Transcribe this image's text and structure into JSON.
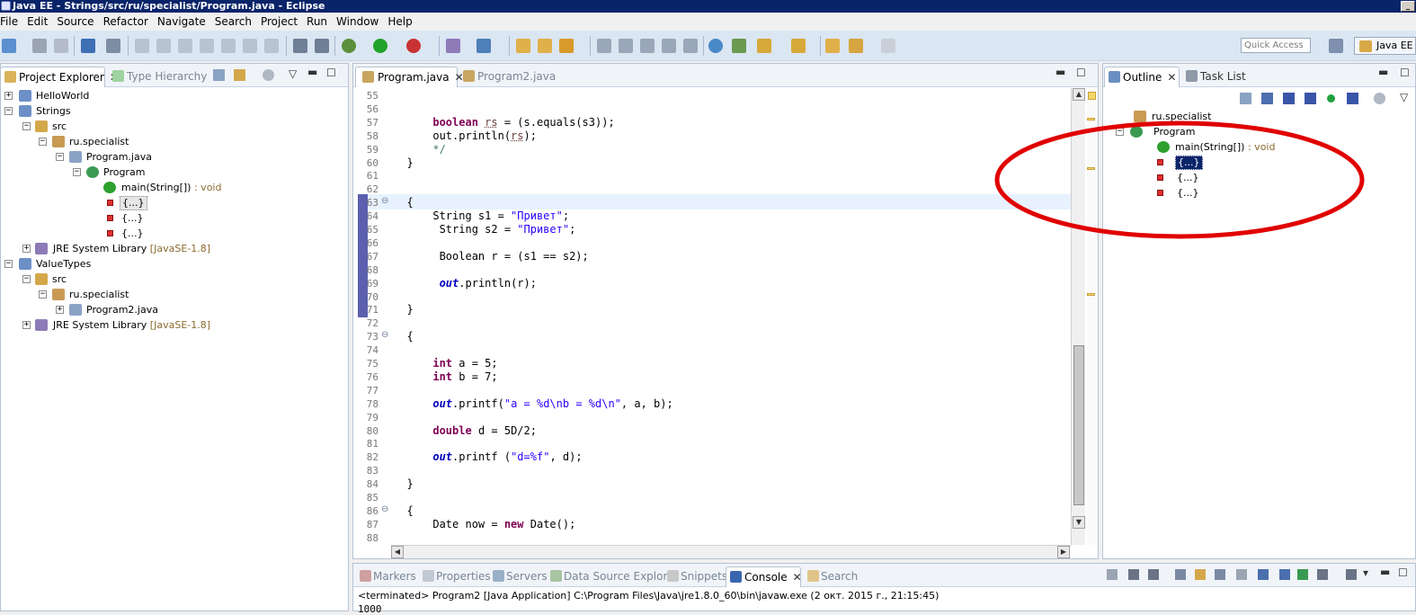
{
  "window": {
    "title": "Java EE - Strings/src/ru/specialist/Program.java - Eclipse"
  },
  "menu": [
    "File",
    "Edit",
    "Source",
    "Refactor",
    "Navigate",
    "Search",
    "Project",
    "Run",
    "Window",
    "Help"
  ],
  "toolbar": {
    "quick_access_placeholder": "Quick Access",
    "perspective": "Java EE"
  },
  "project_explorer": {
    "tabs": [
      {
        "label": "Project Explorer",
        "active": true
      },
      {
        "label": "Type Hierarchy",
        "active": false
      }
    ],
    "tree": [
      {
        "label": "HelloWorld"
      },
      {
        "label": "Strings"
      },
      {
        "label": "src"
      },
      {
        "label": "ru.specialist"
      },
      {
        "label": "Program.java"
      },
      {
        "label": "Program"
      },
      {
        "label": "main(String[])",
        "suffix": " : void"
      },
      {
        "label": "{...}"
      },
      {
        "label": "{...}"
      },
      {
        "label": "{...}"
      },
      {
        "label": "JRE System Library",
        "suffix": " [JavaSE-1.8]"
      },
      {
        "label": "ValueTypes"
      },
      {
        "label": "src"
      },
      {
        "label": "ru.specialist"
      },
      {
        "label": "Program2.java"
      },
      {
        "label": "JRE System Library",
        "suffix": " [JavaSE-1.8]"
      }
    ]
  },
  "editor": {
    "tabs": [
      {
        "label": "Program.java",
        "active": true
      },
      {
        "label": "Program2.java",
        "active": false
      }
    ],
    "line_numbers": [
      "55",
      "56",
      "57",
      "58",
      "59",
      "60",
      "61",
      "62",
      "63",
      "64",
      "65",
      "66",
      "67",
      "68",
      "69",
      "70",
      "71",
      "72",
      "73",
      "74",
      "75",
      "76",
      "77",
      "78",
      "79",
      "80",
      "81",
      "82",
      "83",
      "84",
      "85",
      "86",
      "87",
      "88"
    ]
  },
  "outline": {
    "tabs": [
      {
        "label": "Outline",
        "active": true
      },
      {
        "label": "Task List",
        "active": false
      }
    ],
    "tree": [
      {
        "label": "ru.specialist"
      },
      {
        "label": "Program"
      },
      {
        "label": "main(String[])",
        "suffix": " : void"
      },
      {
        "label": "{...}"
      },
      {
        "label": "{...}"
      },
      {
        "label": "{...}"
      }
    ]
  },
  "bottom": {
    "tabs": [
      {
        "label": "Markers",
        "active": false
      },
      {
        "label": "Properties",
        "active": false
      },
      {
        "label": "Servers",
        "active": false
      },
      {
        "label": "Data Source Explorer",
        "active": false
      },
      {
        "label": "Snippets",
        "active": false
      },
      {
        "label": "Console",
        "active": true
      },
      {
        "label": "Search",
        "active": false
      }
    ],
    "console_status": "<terminated> Program2 [Java Application] C:\\Program Files\\Java\\jre1.8.0_60\\bin\\javaw.exe (2 окт. 2015 г., 21:15:45)",
    "console_output": "1000"
  },
  "colors": {
    "accent": "#0a246a",
    "annotation_ellipse": "#e00000",
    "keyword": "#7f0055",
    "string": "#2a00ff",
    "comment": "#3f7f5f"
  }
}
